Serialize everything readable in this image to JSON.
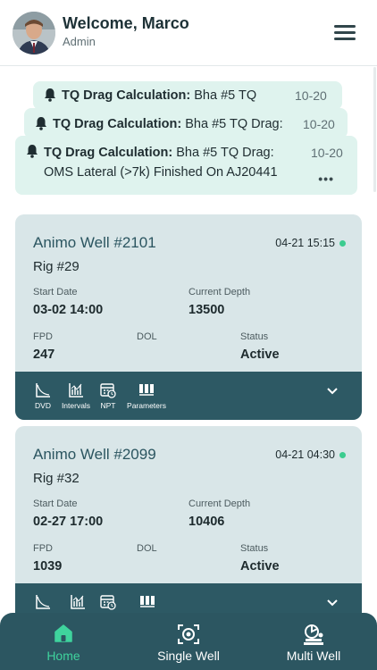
{
  "header": {
    "welcome": "Welcome, Marco",
    "role": "Admin"
  },
  "notifications": [
    {
      "title": "TQ Drag Calculation:",
      "body": "Bha #5 TQ",
      "date": "10-20"
    },
    {
      "title": "TQ Drag Calculation:",
      "body": "Bha #5 TQ Drag:",
      "date": "10-20"
    },
    {
      "title": "TQ Drag Calculation:",
      "body": "Bha #5 TQ Drag:",
      "body_line2": "OMS Lateral (>7k) Finished On AJ20441",
      "date": "10-20",
      "more": "•••"
    }
  ],
  "labels": {
    "start_date": "Start Date",
    "current_depth": "Current Depth",
    "fpd": "FPD",
    "dol": "DOL",
    "status": "Status"
  },
  "actions": [
    "DVD",
    "Intervals",
    "NPT",
    "Parameters"
  ],
  "wells": [
    {
      "name": "Animo Well #2101",
      "timestamp": "04-21 15:15",
      "rig": "Rig #29",
      "start_date": "03-02 14:00",
      "current_depth": "13500",
      "fpd": "247",
      "dol": "",
      "status": "Active"
    },
    {
      "name": "Animo Well #2099",
      "timestamp": "04-21 04:30",
      "rig": "Rig #32",
      "start_date": "02-27 17:00",
      "current_depth": "10406",
      "fpd": "1039",
      "dol": "",
      "status": "Active"
    }
  ],
  "nav": {
    "home": "Home",
    "single_well": "Single Well",
    "multi_well": "Multi Well"
  },
  "colors": {
    "accent": "#3fd39d",
    "nav_bg": "#2c5661",
    "card_bg": "#d9e6e8",
    "notification_bg": "#dff3ee",
    "status_dot": "#3ccc8f"
  },
  "icons": [
    "bell-icon",
    "menu-icon",
    "dvd-icon",
    "intervals-icon",
    "npt-icon",
    "parameters-icon",
    "chevron-down-icon",
    "home-icon",
    "single-well-icon",
    "multi-well-icon"
  ]
}
